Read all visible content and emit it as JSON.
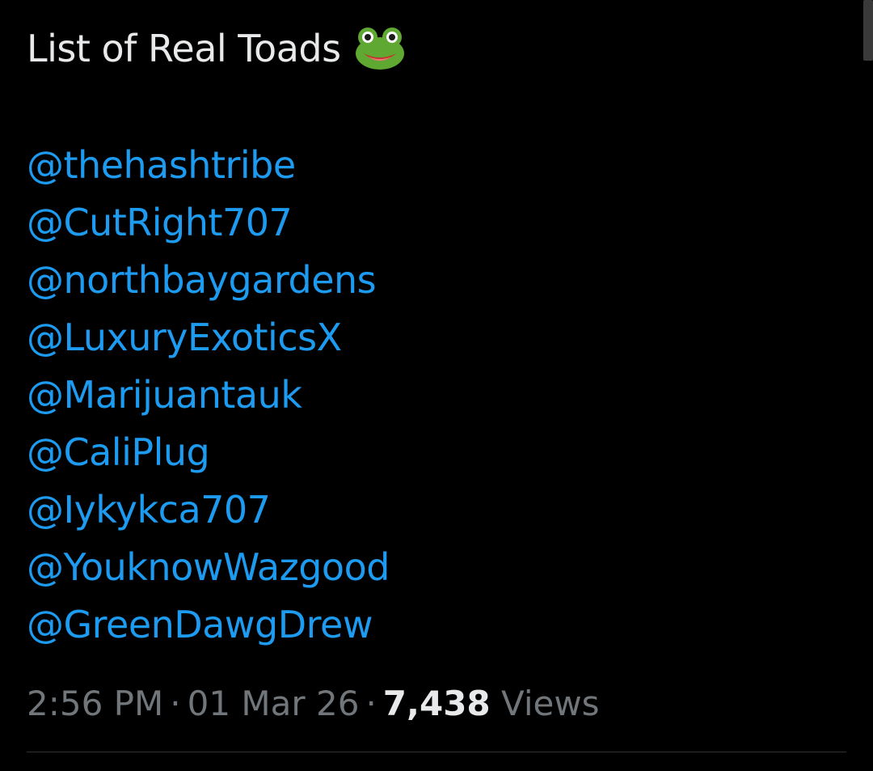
{
  "tweet": {
    "title": "List of Real Toads",
    "title_emoji": "frog-face",
    "mentions": [
      "@thehashtribe",
      "@CutRight707",
      "@northbaygardens",
      "@LuxuryExoticsX",
      "@Marijuantauk",
      "@CaliPlug",
      "@Iykykca707",
      "@YouknowWazgood",
      "@GreenDawgDrew"
    ],
    "time": "2:56 PM",
    "separator": "·",
    "date": "01 Mar 26",
    "views_count": "7,438",
    "views_label": "Views"
  },
  "colors": {
    "background": "#000000",
    "text_primary": "#e7e9ea",
    "text_secondary": "#71767b",
    "mention": "#1d9bf0",
    "divider": "#2f3336"
  }
}
